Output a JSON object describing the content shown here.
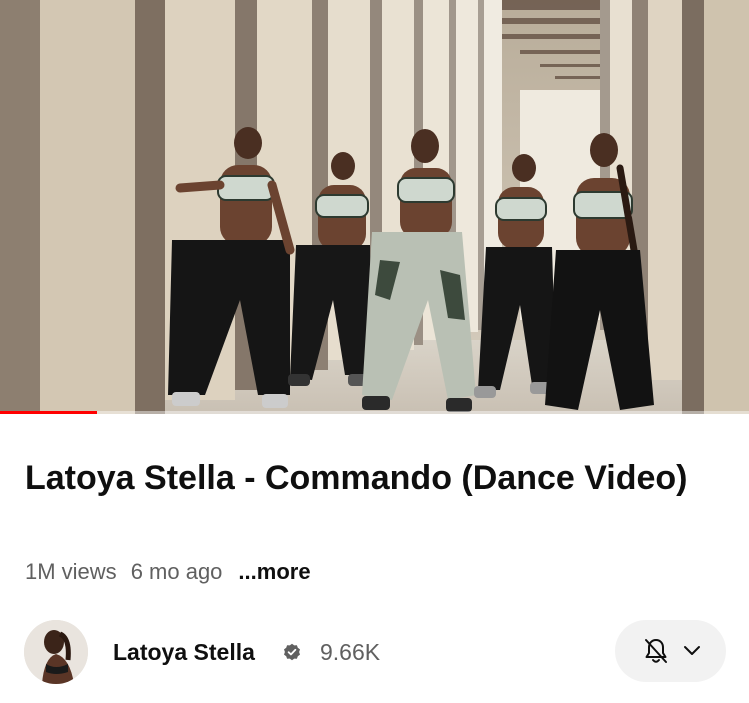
{
  "video": {
    "title": "Latoya Stella - Commando (Dance Video)",
    "views": "1M views",
    "age": "6 mo ago",
    "more_label": "...more",
    "progress": 0.13
  },
  "channel": {
    "name": "Latoya Stella",
    "subscribers": "9.66K",
    "verified": true
  },
  "subscription": {
    "bell_state": "notifications-off",
    "icons": [
      "bell-off-icon",
      "chevron-down-icon"
    ]
  },
  "colors": {
    "progress": "#ff0000",
    "title": "#0f0f0f",
    "secondary": "#606060",
    "pill": "#f2f2f2"
  }
}
